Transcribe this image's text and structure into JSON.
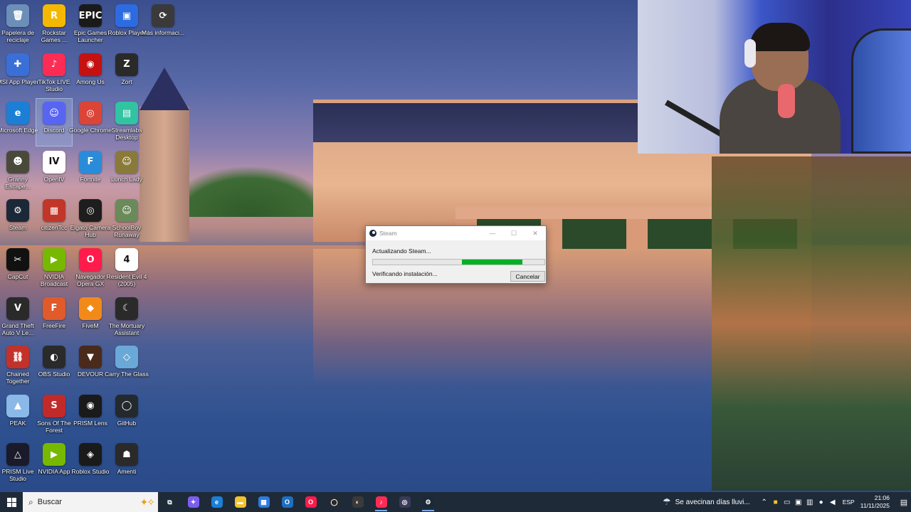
{
  "desktop": {
    "icons": [
      {
        "label": "Papelera de reciclaje",
        "glyph": "🗑",
        "color": "#6b8fb8"
      },
      {
        "label": "Rockstar Games ...",
        "glyph": "R",
        "color": "#f5b800"
      },
      {
        "label": "Epic Games Launcher",
        "glyph": "EPIC",
        "color": "#1a1a1a"
      },
      {
        "label": "Roblox Player",
        "glyph": "▣",
        "color": "#2d6be0"
      },
      {
        "label": "Más informaci...",
        "glyph": "⟳",
        "color": "#3a3a3a"
      },
      {
        "label": "MSI App Player",
        "glyph": "✚",
        "color": "#3a6fd8"
      },
      {
        "label": "TikTok LIVE Studio",
        "glyph": "♪",
        "color": "#fe2c55"
      },
      {
        "label": "Among Us",
        "glyph": "◉",
        "color": "#c51111"
      },
      {
        "label": "Zort",
        "glyph": "Z",
        "color": "#2a2a2a"
      },
      {
        "label": "Microsoft Edge",
        "glyph": "e",
        "color": "#1b7fd6"
      },
      {
        "label": "Discord",
        "glyph": "☺",
        "color": "#5865f2"
      },
      {
        "label": "Google Chrome",
        "glyph": "◎",
        "color": "#db4437"
      },
      {
        "label": "Streamlabs Desktop",
        "glyph": "▤",
        "color": "#31c3a2"
      },
      {
        "label": "Granny Escape...",
        "glyph": "☻",
        "color": "#4a4a3a"
      },
      {
        "label": "OpenIV",
        "glyph": "IV",
        "color": "#ffffff"
      },
      {
        "label": "Fortnite",
        "glyph": "F",
        "color": "#2a8cd8"
      },
      {
        "label": "Lunch Lady",
        "glyph": "☺",
        "color": "#8a7a3a"
      },
      {
        "label": "Steam",
        "glyph": "⚙",
        "color": "#1b2838"
      },
      {
        "label": "citizenTcc",
        "glyph": "▦",
        "color": "#c2362a"
      },
      {
        "label": "Elgato Camera Hub",
        "glyph": "◎",
        "color": "#1d1d1d"
      },
      {
        "label": "SchoolBoy Runaway",
        "glyph": "☺",
        "color": "#6a8a5a"
      },
      {
        "label": "CapCut",
        "glyph": "✂",
        "color": "#111111"
      },
      {
        "label": "NVIDIA Broadcast",
        "glyph": "▶",
        "color": "#76b900"
      },
      {
        "label": "Navegador Opera GX",
        "glyph": "O",
        "color": "#ff1b4b"
      },
      {
        "label": "Resident Evil 4 (2005)",
        "glyph": "4",
        "color": "#ffffff"
      },
      {
        "label": "Grand Theft Auto V Le...",
        "glyph": "V",
        "color": "#2a2a2a"
      },
      {
        "label": "FreeFire",
        "glyph": "F",
        "color": "#e05a2a"
      },
      {
        "label": "FiveM",
        "glyph": "◆",
        "color": "#f28a1a"
      },
      {
        "label": "The Mortuary Assistant",
        "glyph": "☾",
        "color": "#2a2a2a"
      },
      {
        "label": "Chained Together",
        "glyph": "⛓",
        "color": "#c2322a"
      },
      {
        "label": "OBS Studio",
        "glyph": "◐",
        "color": "#2a2a2a"
      },
      {
        "label": "DEVOUR",
        "glyph": "▼",
        "color": "#4a2a1a"
      },
      {
        "label": "Carry The Glass",
        "glyph": "◇",
        "color": "#6aa8d8"
      },
      {
        "label": "PEAK",
        "glyph": "▲",
        "color": "#8ab8e8"
      },
      {
        "label": "Sons Of The Forest",
        "glyph": "S",
        "color": "#c22a2a"
      },
      {
        "label": "PRISM Lens",
        "glyph": "◉",
        "color": "#1a1a1a"
      },
      {
        "label": "GitHub",
        "glyph": "◯",
        "color": "#24292e"
      },
      {
        "label": "PRISM Live Studio",
        "glyph": "△",
        "color": "#1a1a2a"
      },
      {
        "label": "NVIDIA App",
        "glyph": "▶",
        "color": "#76b900"
      },
      {
        "label": "Roblox Studio",
        "glyph": "◈",
        "color": "#1a1a1a"
      },
      {
        "label": "Amenti",
        "glyph": "☗",
        "color": "#2a2a2a"
      }
    ]
  },
  "steam_dialog": {
    "title": "Steam",
    "status": "Actualizando Steam...",
    "substatus": "Verificando instalación...",
    "cancel_label": "Cancelar",
    "progress_start": 0.52,
    "progress_end": 0.87
  },
  "taskbar": {
    "search_placeholder": "Buscar",
    "apps": [
      {
        "name": "task-view",
        "glyph": "⧉",
        "color": "#1f2a38"
      },
      {
        "name": "copilot",
        "glyph": "✦",
        "color": "#7b5ef0"
      },
      {
        "name": "edge",
        "glyph": "e",
        "color": "#1b7fd6"
      },
      {
        "name": "file-explorer",
        "glyph": "▬",
        "color": "#f2c230"
      },
      {
        "name": "store",
        "glyph": "▦",
        "color": "#2d7be0"
      },
      {
        "name": "outlook",
        "glyph": "O",
        "color": "#1f6fc0"
      },
      {
        "name": "opera-gx",
        "glyph": "O",
        "color": "#ff1b4b"
      },
      {
        "name": "github",
        "glyph": "◯",
        "color": "#24292e"
      },
      {
        "name": "obs",
        "glyph": "◐",
        "color": "#3a3a3a"
      },
      {
        "name": "tiktok-live",
        "glyph": "♪",
        "color": "#fe2c55"
      },
      {
        "name": "elgato",
        "glyph": "◎",
        "color": "#3a3a5a"
      },
      {
        "name": "steam",
        "glyph": "⚙",
        "color": "#1b2838"
      }
    ],
    "weather_text": "Se avecinan días lluvi...",
    "language": "ESP",
    "time": "21:06",
    "date": "11/11/2025"
  }
}
